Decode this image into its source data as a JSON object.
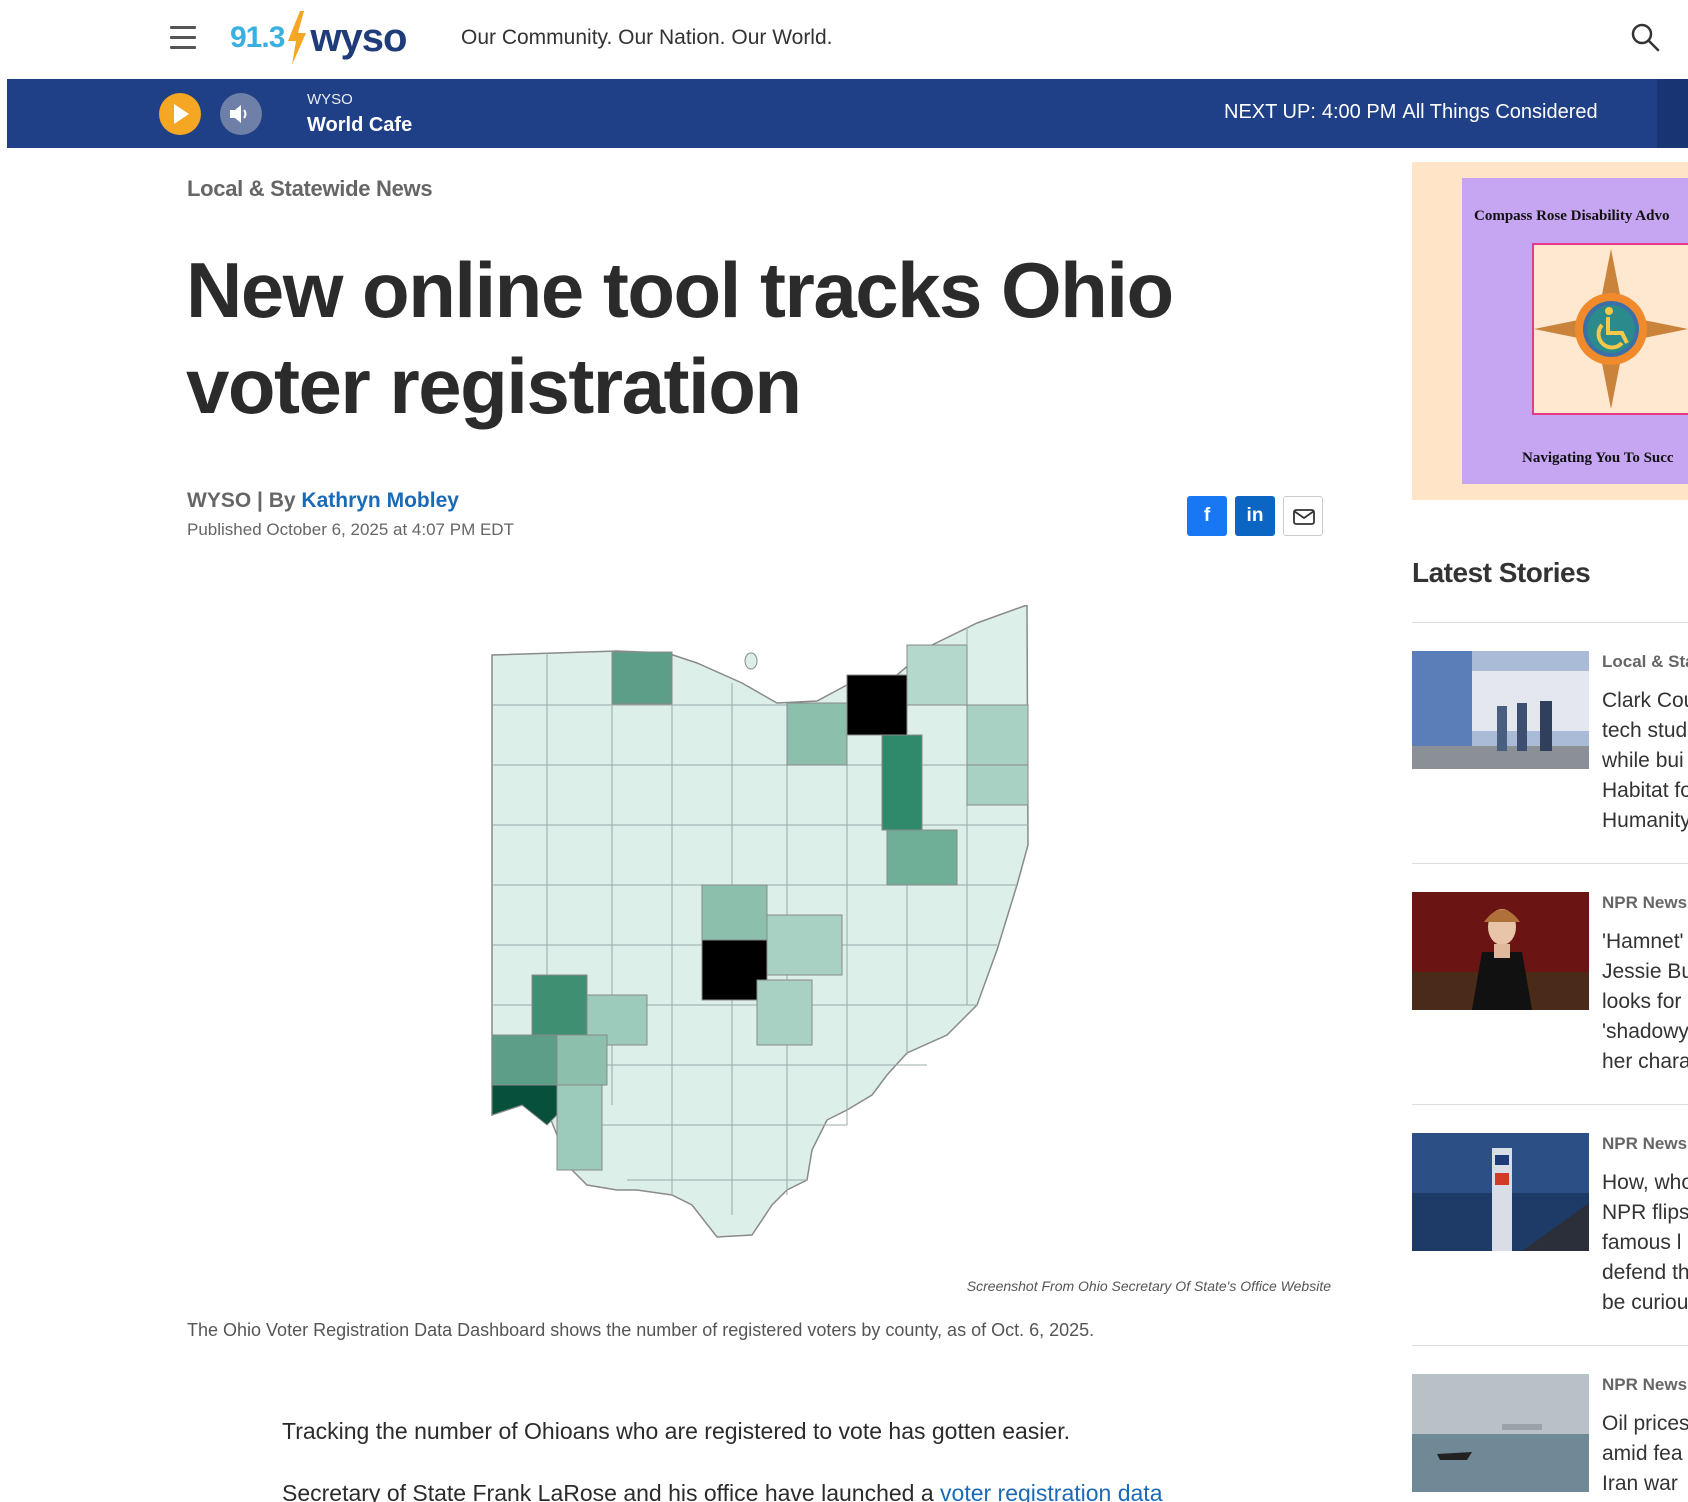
{
  "header": {
    "logo_freq": "91.3",
    "logo_call": "wyso",
    "tagline": "Our Community. Our Nation. Our World."
  },
  "player": {
    "station": "WYSO",
    "program": "World Cafe",
    "next_up_label": "NEXT UP:",
    "next_up_time": "4:00 PM",
    "next_up_show": "All Things Considered"
  },
  "article": {
    "section": "Local & Statewide News",
    "headline": "New online tool tracks Ohio voter registration",
    "byline_org": "WYSO",
    "byline_sep": " | By ",
    "author": "Kathryn Mobley",
    "published": "Published October 6, 2025 at 4:07 PM EDT",
    "image_credit": "Screenshot From Ohio Secretary Of State's Office Website",
    "caption": "The Ohio Voter Registration Data Dashboard shows the number of registered voters by county, as of Oct. 6, 2025.",
    "para1": "Tracking the number of Ohioans who are registered to vote has gotten easier.",
    "para2_prefix": "Secretary of State Frank LaRose and his office have launched a ",
    "para2_link": "voter registration data"
  },
  "share": {
    "facebook": "f",
    "linkedin": "in"
  },
  "ad": {
    "title": "Compass Rose Disability Advo",
    "subtitle": "Navigating You To Succ"
  },
  "sidebar": {
    "latest_title": "Latest Stories",
    "stories": [
      {
        "category": "Local & Sta",
        "lines": [
          "Clark Cou",
          "tech stud",
          "while bui",
          "Habitat fo",
          "Humanity"
        ]
      },
      {
        "category": "NPR News",
        "lines": [
          "'Hamnet'",
          "Jessie Bu",
          "looks for",
          "'shadowy",
          "her chara"
        ]
      },
      {
        "category": "NPR News",
        "lines": [
          "How, who",
          "NPR flips",
          "famous l",
          "defend th",
          "be curiou"
        ]
      },
      {
        "category": "NPR News",
        "lines": [
          "Oil prices",
          "amid fea",
          "Iran war"
        ]
      }
    ]
  },
  "colors": {
    "player_bg": "#1f3f86",
    "accent_orange": "#f5a623",
    "link_blue": "#1a6ab8",
    "map_light": "#dcefe9",
    "map_dark": "#0b4a3a"
  }
}
